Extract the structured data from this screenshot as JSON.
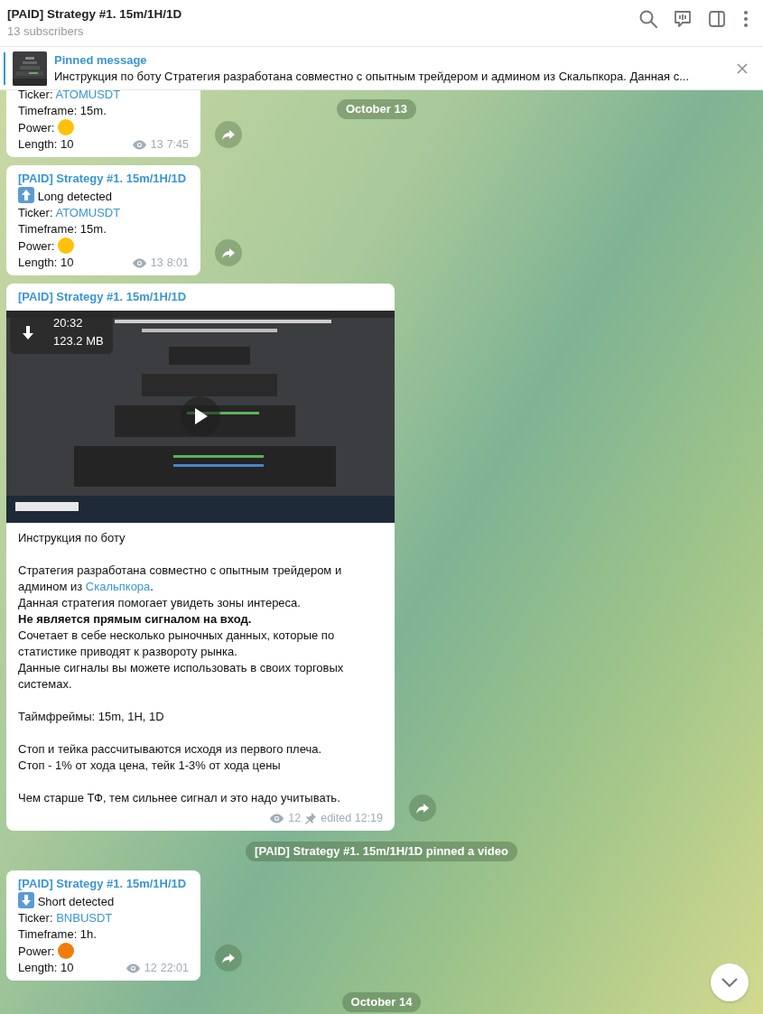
{
  "header": {
    "title": "[PAID] Strategy #1. 15m/1H/1D",
    "subtitle": "13 subscribers"
  },
  "pinned": {
    "title": "Pinned message",
    "text": "Инструкция по боту  Стратегия разработана совместно с опытным трейдером и админом из Скальпкора. Данная с..."
  },
  "sticky_date": "October 13",
  "messages": [
    {
      "kind": "signal",
      "ticker_label": "Ticker:",
      "ticker": "ATOMUSDT",
      "timeframe": "Timeframe: 15m.",
      "power_label": "Power:",
      "color": "#ffc107",
      "length": "Length: 10",
      "views": "13",
      "time": "7:45"
    },
    {
      "kind": "signal",
      "author": "[PAID] Strategy #1. 15m/1H/1D",
      "direction": {
        "kind": "up",
        "text": "Long detected"
      },
      "ticker_label": "Ticker:",
      "ticker": "ATOMUSDT",
      "timeframe": "Timeframe: 15m.",
      "power_label": "Power:",
      "color": "#ffc107",
      "length": "Length: 10",
      "views": "13",
      "time": "8:01"
    },
    {
      "kind": "video",
      "author": "[PAID] Strategy #1. 15m/1H/1D",
      "duration": "20:32",
      "size": "123.2 MB",
      "caption": [
        [
          [
            {
              "text": "Инструкция по боту"
            }
          ]
        ],
        [
          [
            {
              "text": "Стратегия разработана совместно с опытным трейдером и"
            }
          ],
          [
            {
              "text": "админом из "
            },
            {
              "text": "Скальпкора",
              "link": true
            },
            {
              "text": "."
            }
          ],
          [
            {
              "text": "Данная стратегия помогает увидеть зоны интереса."
            }
          ],
          [
            {
              "text": "**Не является прямым сигналом на вход.**"
            }
          ],
          [
            {
              "text": "Сочетает в себе несколько рыночных данных, которые по"
            }
          ],
          [
            {
              "text": "статистике приводят к развороту рынка."
            }
          ],
          [
            {
              "text": "Данные сигналы вы можете использовать в своих торговых"
            }
          ],
          [
            {
              "text": "системах."
            }
          ]
        ],
        [
          [
            {
              "text": "Таймфреймы: 15m, 1H, 1D"
            }
          ]
        ],
        [
          [
            {
              "text": "Стоп и тейка рассчитываются исходя из первого плеча."
            }
          ],
          [
            {
              "text": "Стоп - 1% от хода цена, тейк 1-3% от хода цены"
            }
          ]
        ],
        [
          [
            {
              "text": "Чем старше ТФ, тем сильнее сигнал и это надо учитывать."
            }
          ]
        ]
      ],
      "views": "12",
      "pinned": true,
      "time": "edited 12:19"
    },
    {
      "kind": "service",
      "text": "[PAID] Strategy #1. 15m/1H/1D pinned a video"
    },
    {
      "kind": "signal",
      "author": "[PAID] Strategy #1. 15m/1H/1D",
      "direction": {
        "kind": "down",
        "text": "Short detected"
      },
      "ticker_label": "Ticker:",
      "ticker": "BNBUSDT",
      "timeframe": "Timeframe: 1h.",
      "power_label": "Power:",
      "color": "#f07d0a",
      "length": "Length: 10",
      "views": "12",
      "time": "22:01"
    },
    {
      "kind": "date",
      "text": "October 14"
    }
  ]
}
